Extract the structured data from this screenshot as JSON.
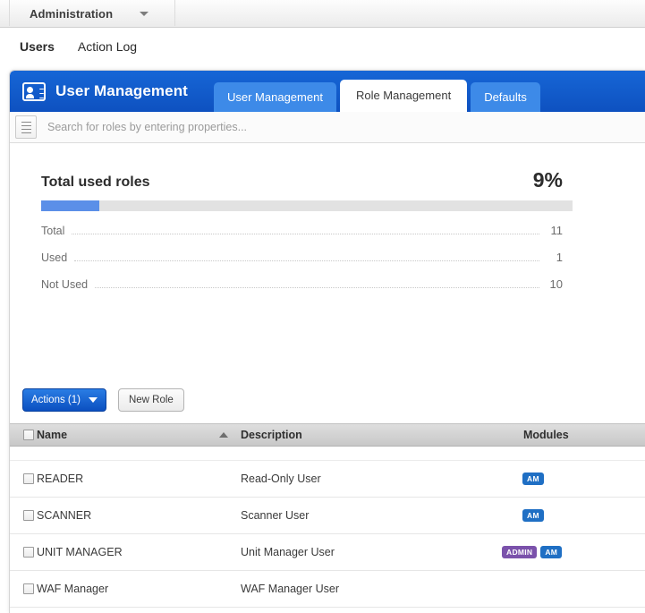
{
  "topbar": {
    "menu_label": "Administration",
    "caret_icon": "chevron-down-icon"
  },
  "subnav": {
    "items": [
      {
        "label": "Users",
        "active": true
      },
      {
        "label": "Action Log",
        "active": false
      }
    ]
  },
  "panel": {
    "icon": "id-card-icon",
    "title": "User Management",
    "tabs": [
      {
        "label": "User Management",
        "active": false
      },
      {
        "label": "Role Management",
        "active": true
      },
      {
        "label": "Defaults",
        "active": false
      }
    ]
  },
  "search": {
    "icon": "list-properties-icon",
    "value": "",
    "placeholder": "Search for roles by entering properties..."
  },
  "stats": {
    "title": "Total used roles",
    "percent_label": "9%",
    "percent_value": 9,
    "progress_fill_percent": 11,
    "rows": [
      {
        "label": "Total",
        "value": "11"
      },
      {
        "label": "Used",
        "value": "1"
      },
      {
        "label": "Not Used",
        "value": "10"
      }
    ]
  },
  "toolbar": {
    "actions_label": "Actions (1)",
    "actions_caret_icon": "chevron-down-icon",
    "new_role_label": "New Role"
  },
  "table": {
    "columns": {
      "name": "Name",
      "description": "Description",
      "modules": "Modules"
    },
    "sort": {
      "column": "Name",
      "direction": "asc",
      "icon": "sort-ascending-icon"
    },
    "rows": [
      {
        "name": "READER",
        "description": "Read-Only User",
        "modules": [
          {
            "label": "AM",
            "color": "#1f6fc4"
          }
        ]
      },
      {
        "name": "SCANNER",
        "description": "Scanner User",
        "modules": [
          {
            "label": "AM",
            "color": "#1f6fc4"
          }
        ]
      },
      {
        "name": "UNIT MANAGER",
        "description": "Unit Manager User",
        "modules": [
          {
            "label": "ADMIN",
            "color": "#7b52ab"
          },
          {
            "label": "AM",
            "color": "#1f6fc4"
          }
        ]
      },
      {
        "name": "WAF Manager",
        "description": "WAF Manager User",
        "modules": []
      }
    ]
  },
  "colors": {
    "header_blue": "#0e51c0",
    "tab_blue": "#3d8ae8",
    "progress_blue": "#5b8fe8",
    "badge_am": "#1f6fc4",
    "badge_admin": "#7b52ab",
    "button_blue": "#0b4fc0"
  }
}
